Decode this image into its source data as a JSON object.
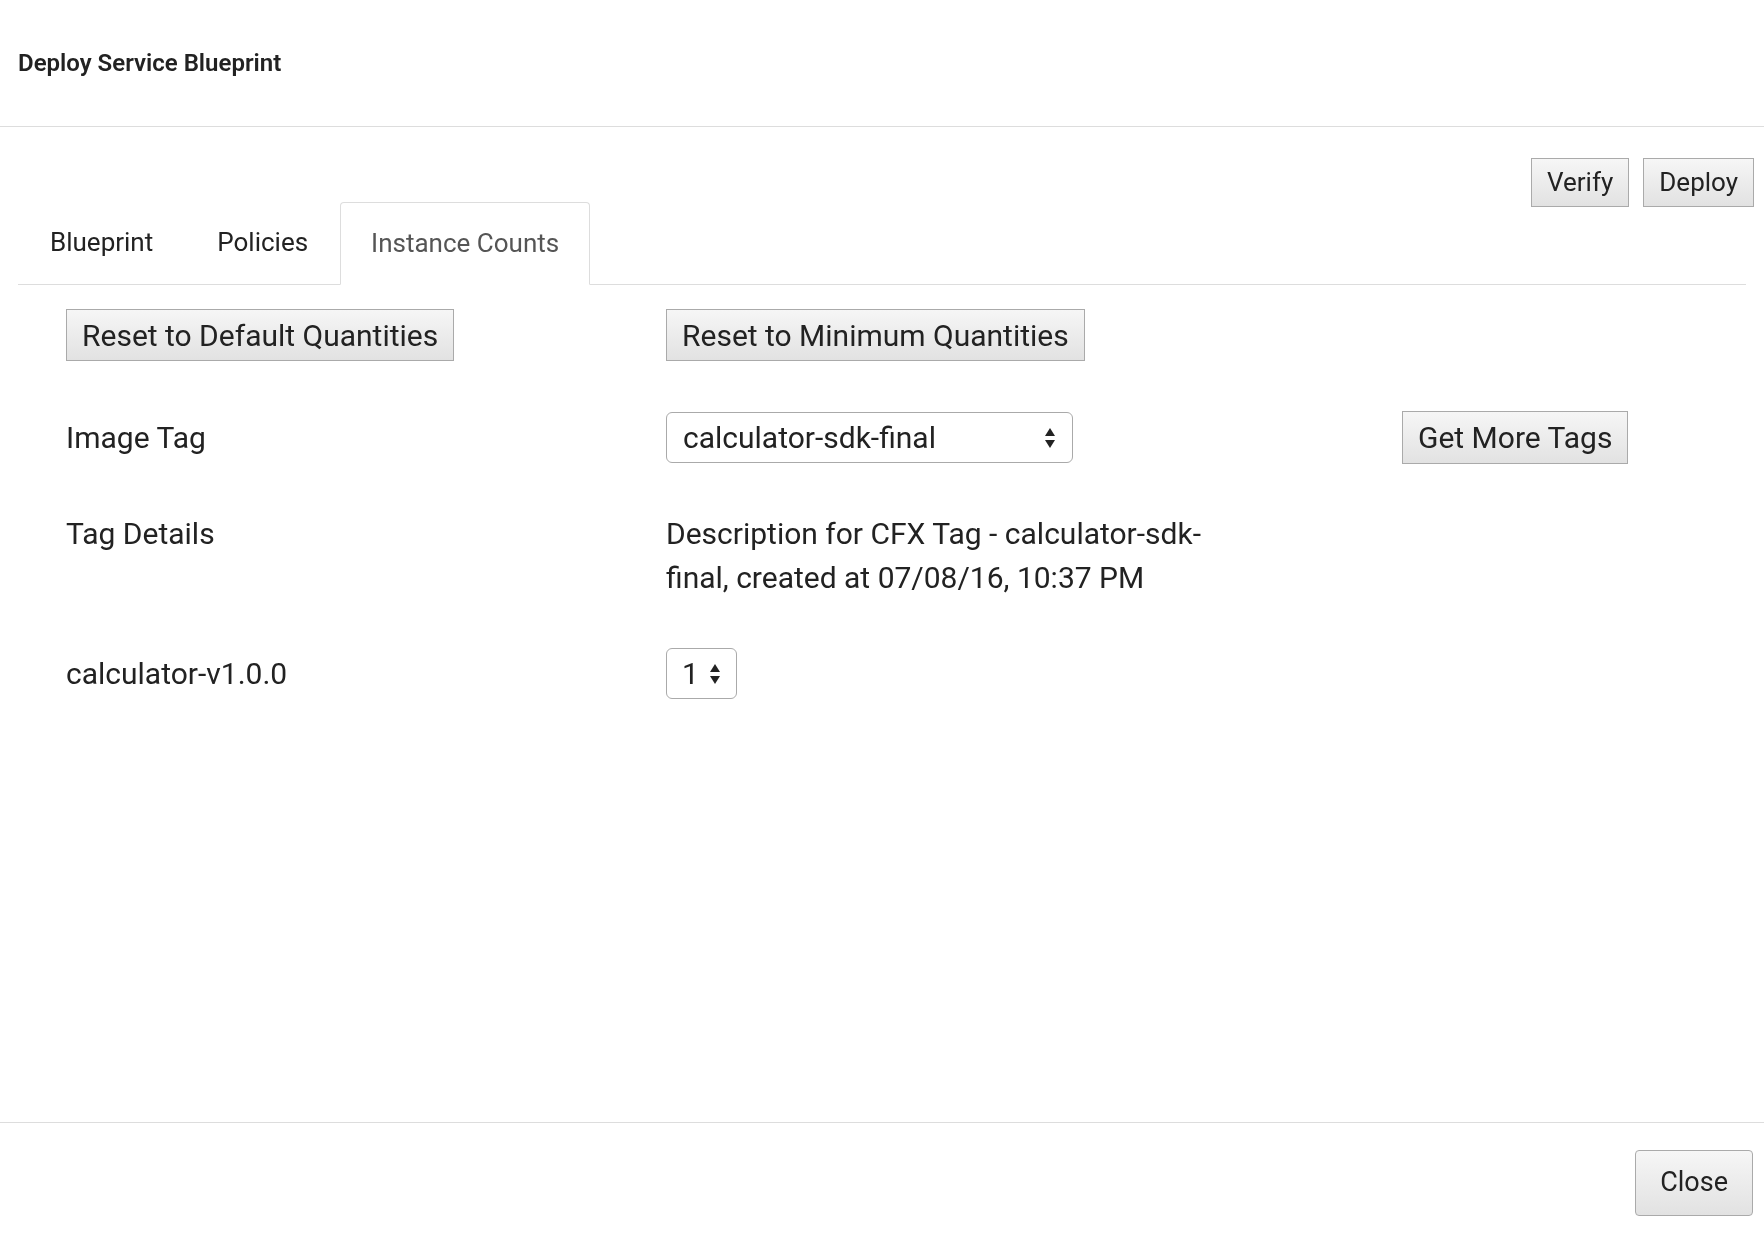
{
  "dialog": {
    "title": "Deploy Service Blueprint"
  },
  "actions": [
    "Verify",
    "Deploy"
  ],
  "tabs": [
    {
      "label": "Blueprint",
      "selected": false
    },
    {
      "label": "Policies",
      "selected": false
    },
    {
      "label": "Instance Counts",
      "selected": true
    }
  ],
  "reset_buttons": [
    "Reset to Default Quantities",
    "Reset to Minimum Quantities"
  ],
  "image_tag": {
    "label": "Image Tag",
    "value": "calculator-sdk-final",
    "button": "Get More Tags"
  },
  "tag_details": {
    "label": "Tag Details",
    "text": "Description for CFX Tag - calculator-sdk-final, created at 07/08/16, 10:37 PM"
  },
  "instances": [
    {
      "label": "calculator-v1.0.0",
      "value": "1"
    }
  ],
  "footer": {
    "close": "Close"
  }
}
